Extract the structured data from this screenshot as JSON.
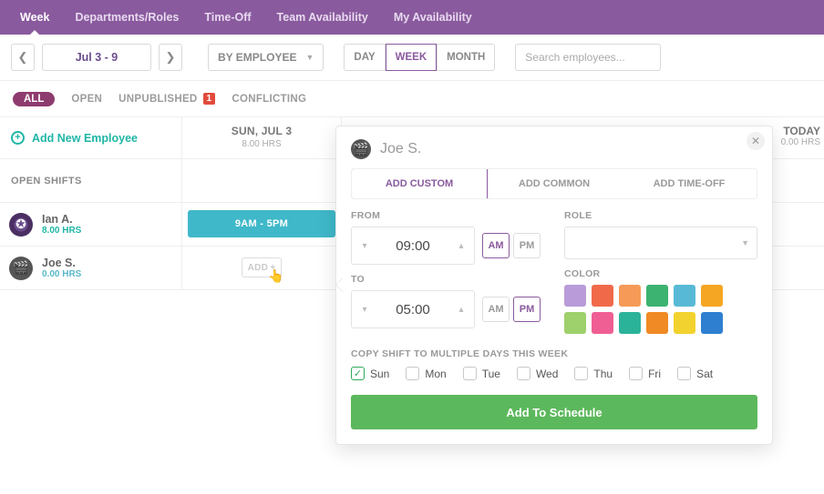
{
  "topnav": {
    "items": [
      {
        "label": "Week",
        "active": true
      },
      {
        "label": "Departments/Roles"
      },
      {
        "label": "Time-Off"
      },
      {
        "label": "Team Availability"
      },
      {
        "label": "My Availability"
      }
    ]
  },
  "toolbar": {
    "date_range": "Jul 3 - 9",
    "group_by": "BY EMPLOYEE",
    "views": [
      {
        "label": "DAY"
      },
      {
        "label": "WEEK",
        "active": true
      },
      {
        "label": "MONTH"
      }
    ],
    "search_placeholder": "Search employees..."
  },
  "filters": {
    "all": "ALL",
    "open": "OPEN",
    "unpublished": "UNPUBLISHED",
    "unpublished_count": "1",
    "conflicting": "CONFLICTING"
  },
  "grid": {
    "add_employee": "Add New Employee",
    "day_header": {
      "label": "SUN, JUL 3",
      "hrs": "8.00 HRS"
    },
    "today_header": {
      "label": "TODAY",
      "hrs": "0.00 HRS"
    },
    "open_shifts": "OPEN SHIFTS",
    "employees": [
      {
        "name": "Ian A.",
        "hours": "8.00 HRS",
        "avatar": "compass",
        "shift": "9AM - 5PM"
      },
      {
        "name": "Joe S.",
        "hours": "0.00 HRS",
        "avatar": "film",
        "add_label": "ADD"
      }
    ]
  },
  "popover": {
    "employee": "Joe S.",
    "tabs": [
      {
        "label": "ADD CUSTOM",
        "active": true
      },
      {
        "label": "ADD COMMON"
      },
      {
        "label": "ADD TIME-OFF"
      }
    ],
    "from_label": "FROM",
    "to_label": "TO",
    "from_time": "09:00",
    "from_ampm": "AM",
    "to_time": "05:00",
    "to_ampm": "PM",
    "role_label": "ROLE",
    "role_value": "",
    "color_label": "COLOR",
    "colors": [
      "#b89bd8",
      "#f06a4a",
      "#f59a57",
      "#3cb371",
      "#58b9d6",
      "#f5a623",
      "#9ed06c",
      "#ef5f93",
      "#2bb39a",
      "#f08a24",
      "#f2d22e",
      "#2f7fd1"
    ],
    "copy_label": "COPY SHIFT TO MULTIPLE DAYS THIS WEEK",
    "days": [
      {
        "label": "Sun",
        "checked": true
      },
      {
        "label": "Mon"
      },
      {
        "label": "Tue"
      },
      {
        "label": "Wed"
      },
      {
        "label": "Thu"
      },
      {
        "label": "Fri"
      },
      {
        "label": "Sat"
      }
    ],
    "submit": "Add To Schedule"
  }
}
